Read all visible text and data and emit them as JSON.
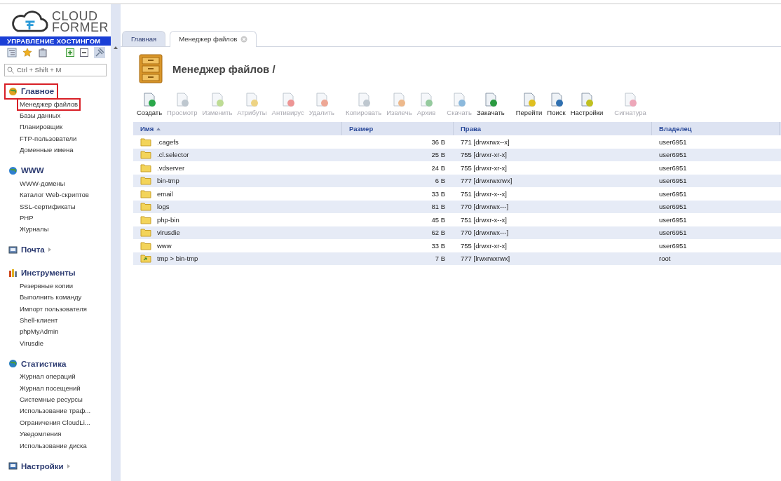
{
  "logo": {
    "line1": "CLOUD",
    "line2": "FORMER",
    "banner": "УПРАВЛЕНИЕ ХОСТИНГОМ"
  },
  "sidebar": {
    "search": {
      "placeholder": "Ctrl + Shift + M"
    },
    "groups": [
      {
        "title": "Главное",
        "highlighted": true,
        "expanded": true,
        "items": [
          {
            "label": "Менеджер файлов",
            "selected": true
          },
          {
            "label": "Базы данных",
            "selected": false
          },
          {
            "label": "Планировщик",
            "selected": false
          },
          {
            "label": "FTP-пользователи",
            "selected": false
          },
          {
            "label": "Доменные имена",
            "selected": false
          }
        ]
      },
      {
        "title": "WWW",
        "highlighted": false,
        "expanded": true,
        "items": [
          {
            "label": "WWW-домены",
            "selected": false
          },
          {
            "label": "Каталог Web-скриптов",
            "selected": false
          },
          {
            "label": "SSL-сертификаты",
            "selected": false
          },
          {
            "label": "PHP",
            "selected": false
          },
          {
            "label": "Журналы",
            "selected": false
          }
        ]
      },
      {
        "title": "Почта",
        "highlighted": false,
        "expanded": false
      },
      {
        "title": "Инструменты",
        "highlighted": false,
        "expanded": true,
        "items": [
          {
            "label": "Резервные копии",
            "selected": false
          },
          {
            "label": "Выполнить команду",
            "selected": false
          },
          {
            "label": "Импорт пользователя",
            "selected": false
          },
          {
            "label": "Shell-клиент",
            "selected": false
          },
          {
            "label": "phpMyAdmin",
            "selected": false
          },
          {
            "label": "Virusdie",
            "selected": false
          }
        ]
      },
      {
        "title": "Статистика",
        "highlighted": false,
        "expanded": true,
        "items": [
          {
            "label": "Журнал операций",
            "selected": false
          },
          {
            "label": "Журнал посещений",
            "selected": false
          },
          {
            "label": "Системные ресурсы",
            "selected": false
          },
          {
            "label": "Использование траф...",
            "selected": false
          },
          {
            "label": "Ограничения CloudLi...",
            "selected": false
          },
          {
            "label": "Уведомления",
            "selected": false
          },
          {
            "label": "Использование диска",
            "selected": false
          }
        ]
      },
      {
        "title": "Настройки",
        "highlighted": false,
        "expanded": false
      }
    ]
  },
  "tabs": [
    {
      "label": "Главная",
      "selected": false,
      "closable": false
    },
    {
      "label": "Менеджер файлов",
      "selected": true,
      "closable": true
    }
  ],
  "page_title": "Менеджер файлов /",
  "toolbar": [
    {
      "buttons": [
        {
          "label": "Создать",
          "disabled": false
        },
        {
          "label": "Просмотр",
          "disabled": true
        },
        {
          "label": "Изменить",
          "disabled": true
        },
        {
          "label": "Атрибуты",
          "disabled": true
        },
        {
          "label": "Антивирус",
          "disabled": true
        },
        {
          "label": "Удалить",
          "disabled": true
        }
      ]
    },
    {
      "buttons": [
        {
          "label": "Копировать",
          "disabled": true
        },
        {
          "label": "Извлечь",
          "disabled": true
        },
        {
          "label": "Архив",
          "disabled": true
        }
      ]
    },
    {
      "buttons": [
        {
          "label": "Скачать",
          "disabled": true
        },
        {
          "label": "Закачать",
          "disabled": false
        }
      ]
    },
    {
      "buttons": [
        {
          "label": "Перейти",
          "disabled": false
        },
        {
          "label": "Поиск",
          "disabled": false
        },
        {
          "label": "Настройки",
          "disabled": false
        }
      ]
    },
    {
      "buttons": [
        {
          "label": "Сигнатура",
          "disabled": true
        }
      ]
    }
  ],
  "table": {
    "columns": [
      {
        "label": "Имя",
        "sorted": true
      },
      {
        "label": "Размер",
        "sorted": false
      },
      {
        "label": "Права",
        "sorted": false
      },
      {
        "label": "Владелец",
        "sorted": false
      }
    ],
    "rows": [
      {
        "kind": "folder",
        "cells": [
          ".cagefs",
          "36 B",
          "771 [drwxrwx--x]",
          "user6951"
        ]
      },
      {
        "kind": "folder",
        "cells": [
          ".cl.selector",
          "25 B",
          "755 [drwxr-xr-x]",
          "user6951"
        ]
      },
      {
        "kind": "folder",
        "cells": [
          ".vdserver",
          "24 B",
          "755 [drwxr-xr-x]",
          "user6951"
        ]
      },
      {
        "kind": "folder",
        "cells": [
          "bin-tmp",
          "6 B",
          "777 [drwxrwxrwx]",
          "user6951"
        ]
      },
      {
        "kind": "folder",
        "cells": [
          "email",
          "33 B",
          "751 [drwxr-x--x]",
          "user6951"
        ]
      },
      {
        "kind": "folder",
        "cells": [
          "logs",
          "81 B",
          "770 [drwxrwx---]",
          "user6951"
        ]
      },
      {
        "kind": "folder",
        "cells": [
          "php-bin",
          "45 B",
          "751 [drwxr-x--x]",
          "user6951"
        ]
      },
      {
        "kind": "folder",
        "cells": [
          "virusdie",
          "62 B",
          "770 [drwxrwx---]",
          "user6951"
        ]
      },
      {
        "kind": "folder",
        "cells": [
          "www",
          "33 B",
          "755 [drwxr-xr-x]",
          "user6951"
        ]
      },
      {
        "kind": "link",
        "cells": [
          "tmp > bin-tmp",
          "7 B",
          "777 [lrwxrwxrwx]",
          "root"
        ]
      }
    ]
  }
}
